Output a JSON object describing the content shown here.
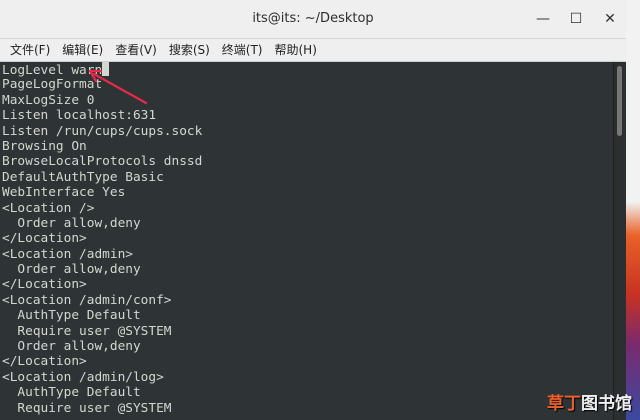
{
  "window": {
    "title": "its@its: ~/Desktop",
    "minimize_glyph": "—",
    "maximize_glyph": "☐",
    "close_glyph": "✕"
  },
  "menu": {
    "items": [
      "文件(F)",
      "编辑(E)",
      "查看(V)",
      "搜索(S)",
      "终端(T)",
      "帮助(H)"
    ]
  },
  "terminal": {
    "lines": [
      "LogLevel warn",
      "PageLogFormat",
      "MaxLogSize 0",
      "Listen localhost:631",
      "Listen /run/cups/cups.sock",
      "Browsing On",
      "BrowseLocalProtocols dnssd",
      "DefaultAuthType Basic",
      "WebInterface Yes",
      "<Location />",
      "  Order allow,deny",
      "</Location>",
      "<Location /admin>",
      "  Order allow,deny",
      "</Location>",
      "<Location /admin/conf>",
      "  AuthType Default",
      "  Require user @SYSTEM",
      "  Order allow,deny",
      "</Location>",
      "<Location /admin/log>",
      "  AuthType Default",
      "  Require user @SYSTEM"
    ]
  },
  "watermark": {
    "part1": "草丁",
    "part2": "图书馆"
  },
  "colors": {
    "terminal_bg": "#2e3436",
    "terminal_fg": "#d3d7cf",
    "annotation_arrow": "#e8294a"
  }
}
